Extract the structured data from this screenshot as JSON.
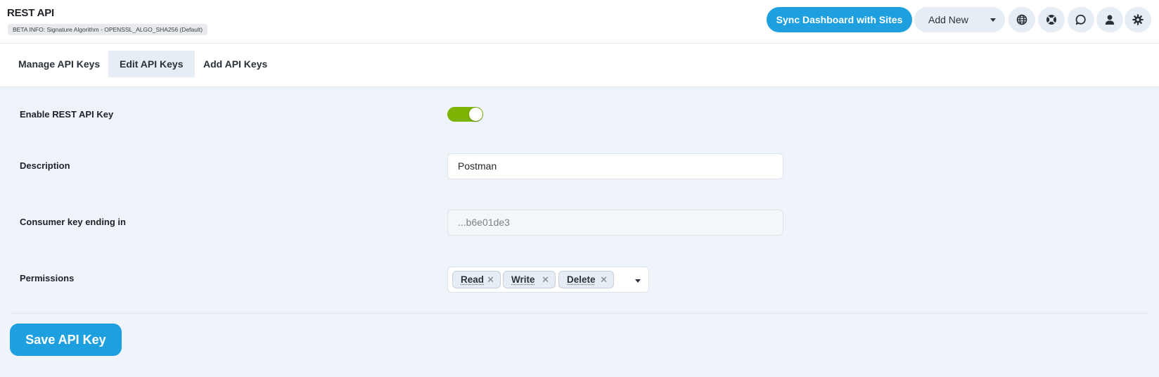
{
  "header": {
    "title": "REST API",
    "beta_info": "BETA INFO: Signature Algorithm - OPENSSL_ALGO_SHA256 (Default)",
    "sync_button": "Sync Dashboard with Sites",
    "add_new_label": "Add New",
    "icons": [
      "globe-icon",
      "lifebuoy-icon",
      "chat-icon",
      "user-icon",
      "settings-icon"
    ]
  },
  "tabs": [
    {
      "label": "Manage API Keys",
      "active": false
    },
    {
      "label": "Edit API Keys",
      "active": true
    },
    {
      "label": "Add API Keys",
      "active": false
    }
  ],
  "form": {
    "enable": {
      "label": "Enable REST API Key",
      "enabled": true
    },
    "description": {
      "label": "Description",
      "value": "Postman"
    },
    "consumer_key": {
      "label": "Consumer key ending in",
      "placeholder": "...b6e01de3"
    },
    "permissions": {
      "label": "Permissions",
      "values": [
        "Read",
        "Write",
        "Delete"
      ]
    }
  },
  "save_button": "Save API Key",
  "colors": {
    "accent": "#1ea0e0",
    "toggle_on": "#7cb304",
    "page_bg": "#eef4f9"
  }
}
